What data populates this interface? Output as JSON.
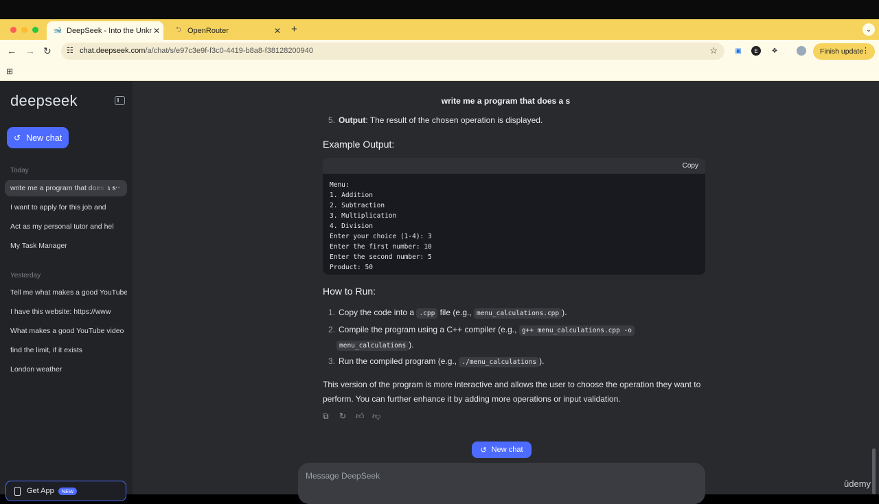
{
  "browser": {
    "tabs": [
      {
        "title": "DeepSeek - Into the Unknown",
        "active": true
      },
      {
        "title": "OpenRouter",
        "active": false
      }
    ],
    "url_host": "chat.deepseek.com",
    "url_path": "/a/chat/s/e97c3e9f-f3c0-4419-b8a8-f38128200940",
    "profile_initial": "E",
    "finish_update_label": "Finish update"
  },
  "sidebar": {
    "logo": "deepseek",
    "new_chat_label": "New chat",
    "today_label": "Today",
    "today_items": [
      "write me a program that does a s",
      "I want to apply for this job and",
      "Act as my personal tutor and hel",
      "My Task Manager"
    ],
    "yesterday_label": "Yesterday",
    "yesterday_items": [
      "Tell me what makes a good YouTube",
      "I have this website: https://www",
      "What makes a good YouTube video",
      "find the limit, if it exists",
      "London weather"
    ],
    "get_app_label": "Get App",
    "get_app_badge": "NEW"
  },
  "chat": {
    "title": "write me a program that does a s",
    "step5_num": "5.",
    "step5_bold": "Output",
    "step5_text": ": The result of the chosen operation is displayed.",
    "example_heading": "Example Output:",
    "copy_label": "Copy",
    "code_output": "Menu:\n1. Addition\n2. Subtraction\n3. Multiplication\n4. Division\nEnter your choice (1-4): 3\nEnter the first number: 10\nEnter the second number: 5\nProduct: 50",
    "howto_heading": "How to Run:",
    "steps": [
      {
        "num": "1.",
        "pre": "Copy the code into a ",
        "code1": ".cpp",
        "mid": " file (e.g., ",
        "code2": "menu_calculations.cpp",
        "post": ")."
      },
      {
        "num": "2.",
        "pre": "Compile the program using a C++ compiler (e.g., ",
        "code1": "g++ menu_calculations.cpp -o",
        "code2": "menu_calculations",
        "post": ")."
      },
      {
        "num": "3.",
        "pre": "Run the compiled program (e.g., ",
        "code1": "./menu_calculations",
        "post": ")."
      }
    ],
    "closing_paragraph": "This version of the program is more interactive and allows the user to choose the operation they want to perform. You can further enhance it by adding more operations or input validation."
  },
  "floating_new_chat_label": "New chat",
  "composer": {
    "placeholder": "Message DeepSeek"
  },
  "watermark": "ûdemy",
  "colors": {
    "accent": "#4d6bfe",
    "tab_strip": "#f6d35c",
    "main_bg": "#292a2d",
    "sidebar_bg": "#212327"
  }
}
